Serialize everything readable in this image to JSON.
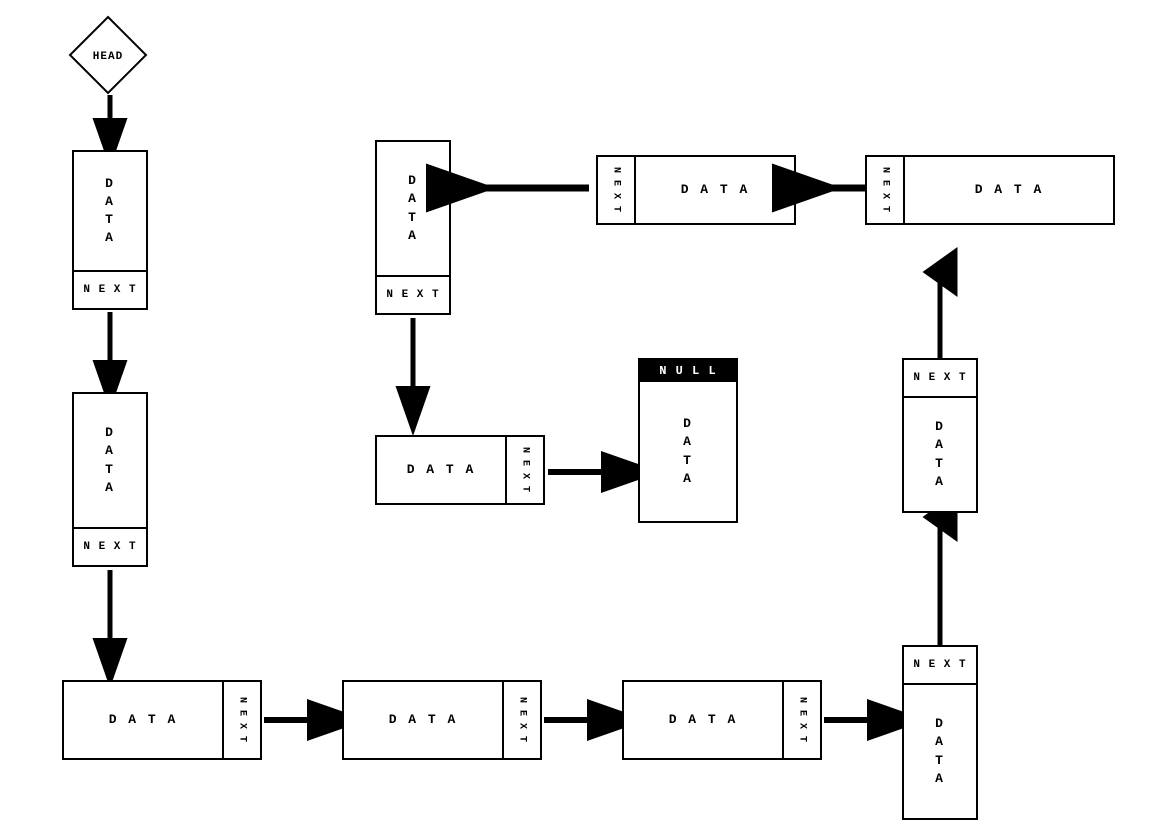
{
  "nodes": {
    "head_label": "HEAD",
    "data_label": "D A T A",
    "next_label": "N E X T",
    "null_label": "NULL",
    "data_vertical": "D\nA\nT\nA",
    "next_vertical": "N\nE\nX\nT"
  }
}
